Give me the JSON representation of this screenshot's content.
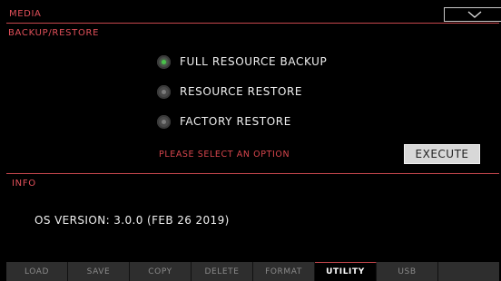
{
  "header": {
    "title": "MEDIA",
    "dropdown_icon": "chevron-down-icon"
  },
  "backup": {
    "title": "BACKUP/RESTORE",
    "options": [
      {
        "label": "FULL RESOURCE BACKUP",
        "selected": true
      },
      {
        "label": "RESOURCE RESTORE",
        "selected": false
      },
      {
        "label": "FACTORY RESTORE",
        "selected": false
      }
    ],
    "status": "PLEASE SELECT AN OPTION",
    "execute_label": "EXECUTE"
  },
  "info": {
    "title": "INFO",
    "os_version": "OS VERSION: 3.0.0 (FEB 26 2019)"
  },
  "tabs": [
    {
      "label": "LOAD"
    },
    {
      "label": "SAVE"
    },
    {
      "label": "COPY"
    },
    {
      "label": "DELETE"
    },
    {
      "label": "FORMAT"
    },
    {
      "label": "UTILITY",
      "active": true
    },
    {
      "label": "USB"
    }
  ],
  "colors": {
    "accent": "#e2505a",
    "radio_on": "#49c14a",
    "background": "#000000"
  }
}
